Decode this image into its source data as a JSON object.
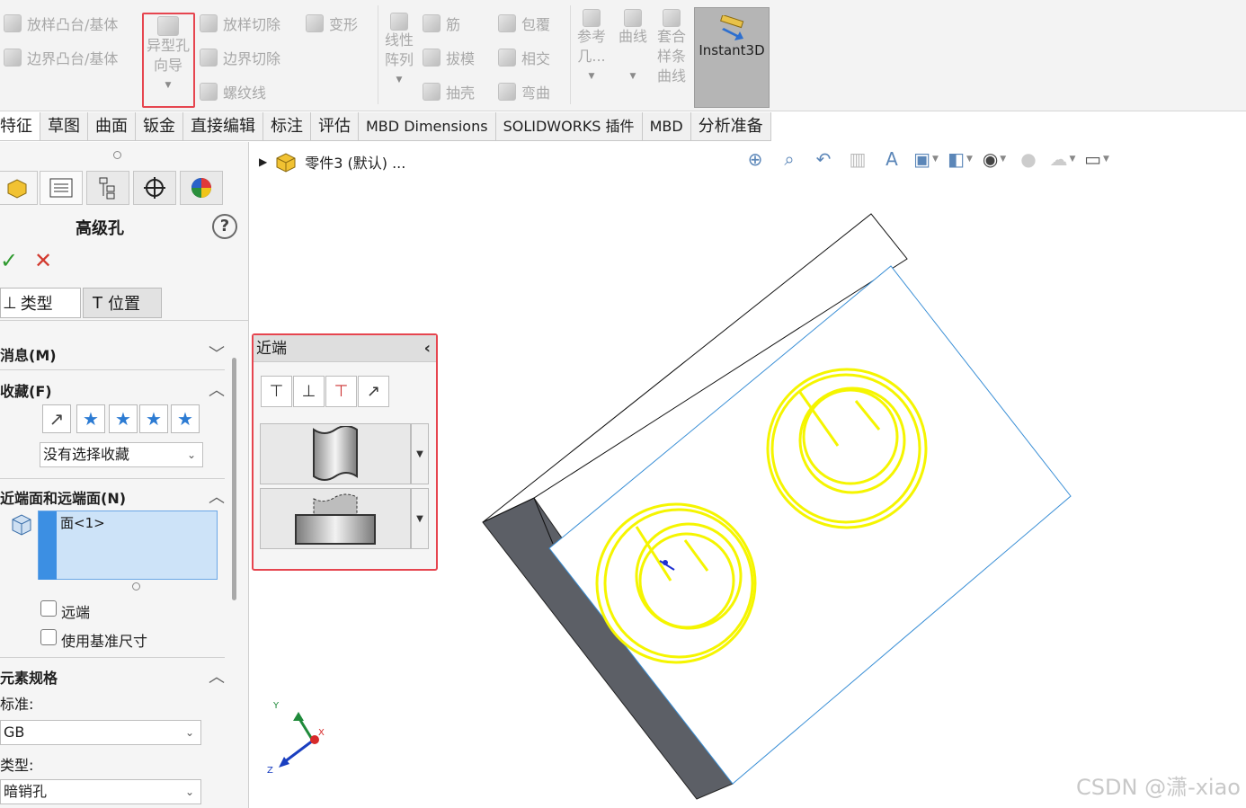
{
  "ribbon": {
    "loft_boss": "放样凸台/基体",
    "boundary_boss": "边界凸台/基体",
    "hole_wizard": [
      "异型孔",
      "向导"
    ],
    "loft_cut": "放样切除",
    "boundary_cut": "边界切除",
    "thread": "螺纹线",
    "deform": "变形",
    "linear_pattern": [
      "线性",
      "阵列"
    ],
    "rib": "筋",
    "draft": "拔模",
    "shell": "抽壳",
    "wrap": "包覆",
    "intersect": "相交",
    "flex": "弯曲",
    "ref_geom": [
      "参考",
      "几..."
    ],
    "curves": "曲线",
    "fit_spline": [
      "套合",
      "样条",
      "曲线"
    ],
    "instant3d": "Instant3D"
  },
  "tabs": [
    "特征",
    "草图",
    "曲面",
    "钣金",
    "直接编辑",
    "标注",
    "评估",
    "MBD Dimensions",
    "SOLIDWORKS 插件",
    "MBD",
    "分析准备"
  ],
  "property_manager": {
    "title": "高级孔",
    "help": "?",
    "ok": "✓",
    "cancel": "✕",
    "type_tab": "类型",
    "position_tab": "位置",
    "message_section": "消息(M)",
    "favorites_section": "收藏(F)",
    "favorites_select": "没有选择收藏",
    "near_far_section": "近端面和远端面(N)",
    "face_item": "面<1>",
    "far_end_label": "远端",
    "use_datum_label": "使用基准尺寸",
    "element_spec_section": "元素规格",
    "standard_label": "标准:",
    "standard_value": "GB",
    "type_label": "类型:",
    "type_value": "暗销孔"
  },
  "viewport": {
    "part_name": "零件3 (默认) ..."
  },
  "near_panel": {
    "title": "近端"
  },
  "triad": {
    "x": "X",
    "y": "Y",
    "z": "Z"
  },
  "watermark": "CSDN @潇-xiao",
  "colors": {
    "highlight": "#e6454f",
    "hole_outline": "#f5f500",
    "edge_blue": "#3a8fd6",
    "side_face": "#5c5f66"
  }
}
